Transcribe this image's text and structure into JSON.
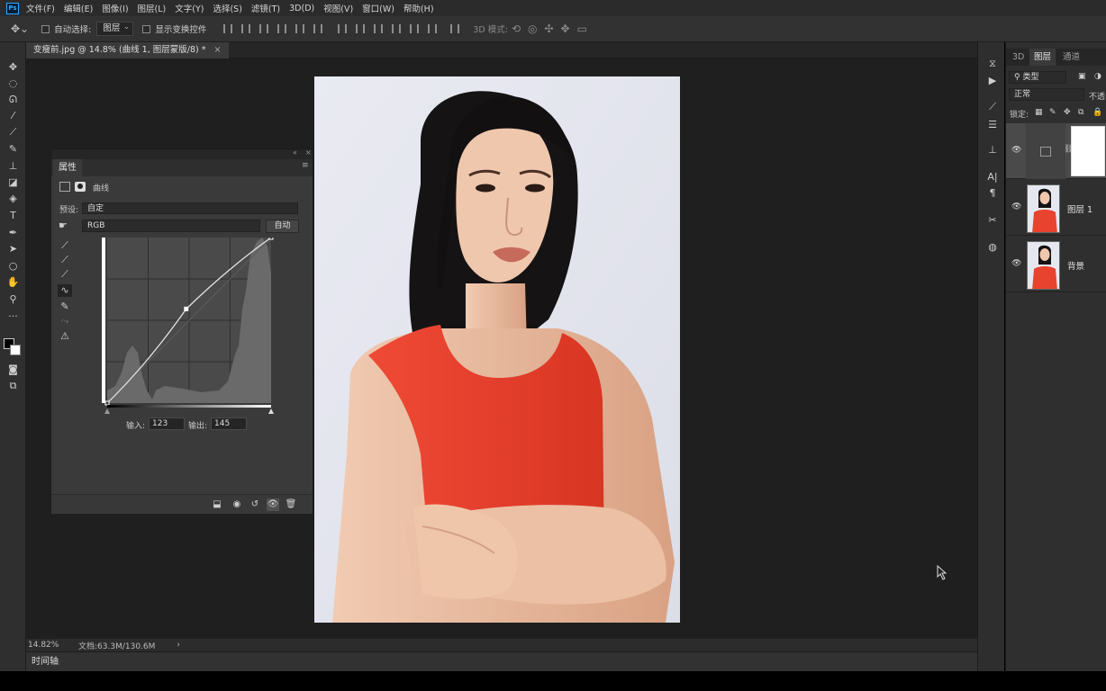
{
  "app": {
    "logo": "Ps"
  },
  "menu": [
    "文件(F)",
    "编辑(E)",
    "图像(I)",
    "图层(L)",
    "文字(Y)",
    "选择(S)",
    "滤镜(T)",
    "3D(D)",
    "视图(V)",
    "窗口(W)",
    "帮助(H)"
  ],
  "options": {
    "auto_select_label": "自动选择:",
    "auto_select_value": "图层",
    "show_transform_label": "显示变换控件",
    "mode_3d_label": "3D 模式:"
  },
  "document": {
    "tab_title": "变瘦前.jpg @ 14.8% (曲线 1, 图层蒙版/8) *",
    "close": "×"
  },
  "status": {
    "zoom": "14.82%",
    "doc_size": "文档:63.3M/130.6M",
    "arrow": "›"
  },
  "timeline": {
    "label": "时间轴"
  },
  "properties": {
    "tab_label": "属性",
    "adjust_name": "曲线",
    "preset_label": "预设:",
    "preset_value": "自定",
    "channel_value": "RGB",
    "auto_button": "自动",
    "input_label": "输入:",
    "input_value": "123",
    "output_label": "输出:",
    "output_value": "145"
  },
  "layers_panel": {
    "tabs": [
      "3D",
      "图层",
      "通道"
    ],
    "active_tab": "图层",
    "filter_label": "类型",
    "blend_mode": "正常",
    "opacity_label": "不透",
    "lock_label": "锁定:",
    "layers": [
      {
        "name": "",
        "kind": "adjustment-curves"
      },
      {
        "name": "图层 1",
        "kind": "pixel"
      },
      {
        "name": "背景",
        "kind": "background"
      }
    ]
  },
  "colors": {
    "accent": "#31a8ff",
    "dress": "#e8432f",
    "backdrop": "#e6e8f0",
    "skin": "#e9b99a",
    "hair": "#141414"
  },
  "curve": {
    "points": [
      [
        0,
        0
      ],
      [
        123,
        145
      ],
      [
        255,
        255
      ]
    ]
  }
}
